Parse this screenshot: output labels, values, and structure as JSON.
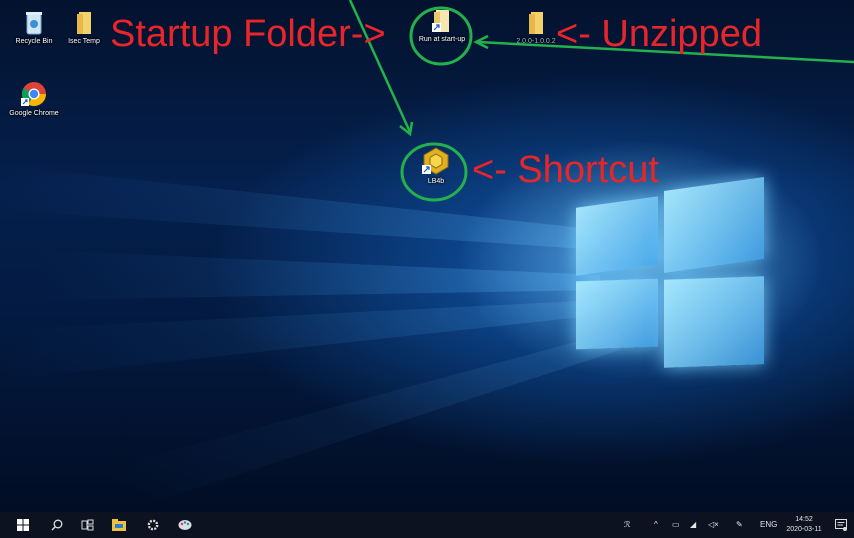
{
  "desktop": {
    "icons": [
      {
        "label": "Recycle Bin",
        "icon": "recycle-bin-icon"
      },
      {
        "label": "Isec Temp",
        "icon": "folder-icon"
      },
      {
        "label": "Google Chrome",
        "icon": "chrome-icon"
      },
      {
        "label": "Run at start-up",
        "icon": "folder-shortcut-icon"
      },
      {
        "label": "2.0.0-1.0.0.2",
        "icon": "folder-icon"
      },
      {
        "label": "LB4b",
        "icon": "app-shortcut-icon"
      }
    ]
  },
  "annotations": {
    "startup_folder": "Startup Folder->",
    "unzipped": "<- Unzipped",
    "shortcut": "<- Shortcut",
    "color": "#e8262a",
    "arrow_color": "#22b14c"
  },
  "taskbar": {
    "start": "windows-start-icon",
    "search": "search-icon",
    "task_view": "task-view-icon",
    "file_explorer": "file-explorer-icon",
    "settings": "gear-icon",
    "paint": "paint-icon"
  },
  "tray": {
    "language": "ENG",
    "time": "14:52",
    "date": "2020-03-11"
  },
  "colors": {
    "taskbar_bg": "#0c1220",
    "wallpaper_accent": "#1e8ee8"
  }
}
